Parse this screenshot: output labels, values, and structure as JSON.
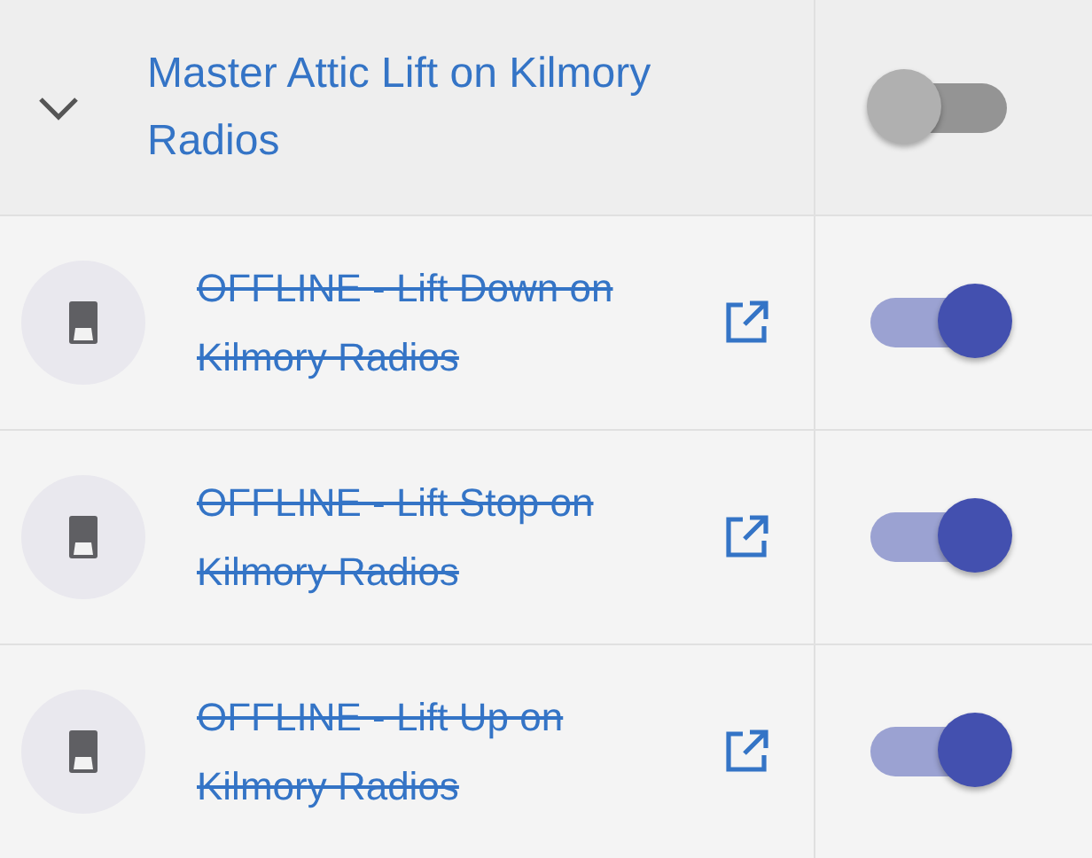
{
  "group": {
    "title": "Master Attic Lift on Kilmory Radios",
    "expanded": true,
    "on": false
  },
  "items": [
    {
      "label": "OFFLINE - Lift Down on Kilmory Radios",
      "offline": true,
      "on": true
    },
    {
      "label": "OFFLINE - Lift Stop on Kilmory Radios",
      "offline": true,
      "on": true
    },
    {
      "label": "OFFLINE - Lift Up on Kilmory Radios",
      "offline": true,
      "on": true
    }
  ]
}
